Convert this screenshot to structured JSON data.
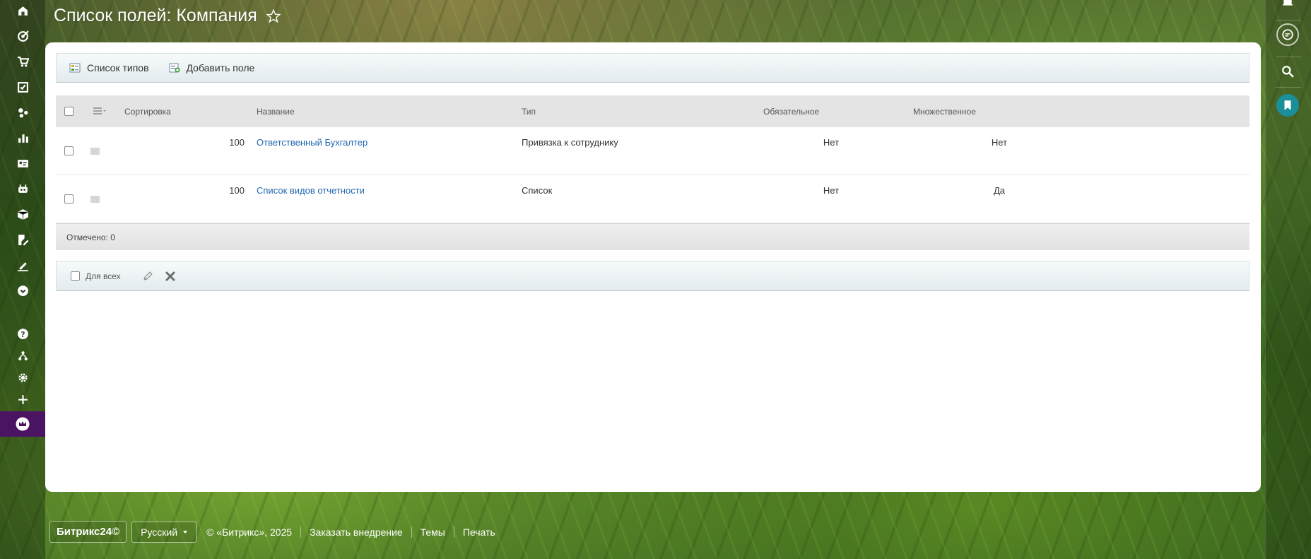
{
  "page": {
    "title": "Список полей: Компания"
  },
  "toolbar": {
    "types_list": "Список типов",
    "add_field": "Добавить поле"
  },
  "grid": {
    "headers": {
      "sort": "Сортировка",
      "name": "Название",
      "type": "Тип",
      "required": "Обязательное",
      "multiple": "Множественное"
    },
    "rows": [
      {
        "sort": "100",
        "name": "Ответственный Бухгалтер",
        "type": "Привязка к сотруднику",
        "required": "Нет",
        "multiple": "Нет"
      },
      {
        "sort": "100",
        "name": "Список видов отчетности",
        "type": "Список",
        "required": "Нет",
        "multiple": "Да"
      }
    ],
    "selected_label": "Отмечено: 0"
  },
  "actions": {
    "for_all": "Для всех"
  },
  "footer": {
    "logo": "Битрикс24©",
    "language": "Русский",
    "copyright": "© «Битрикс», 2025",
    "order": "Заказать внедрение",
    "themes": "Темы",
    "print": "Печать"
  },
  "colors": {
    "link": "#2067b0",
    "active_menu": "#4b1462",
    "copilot": "#1a8f9a"
  }
}
